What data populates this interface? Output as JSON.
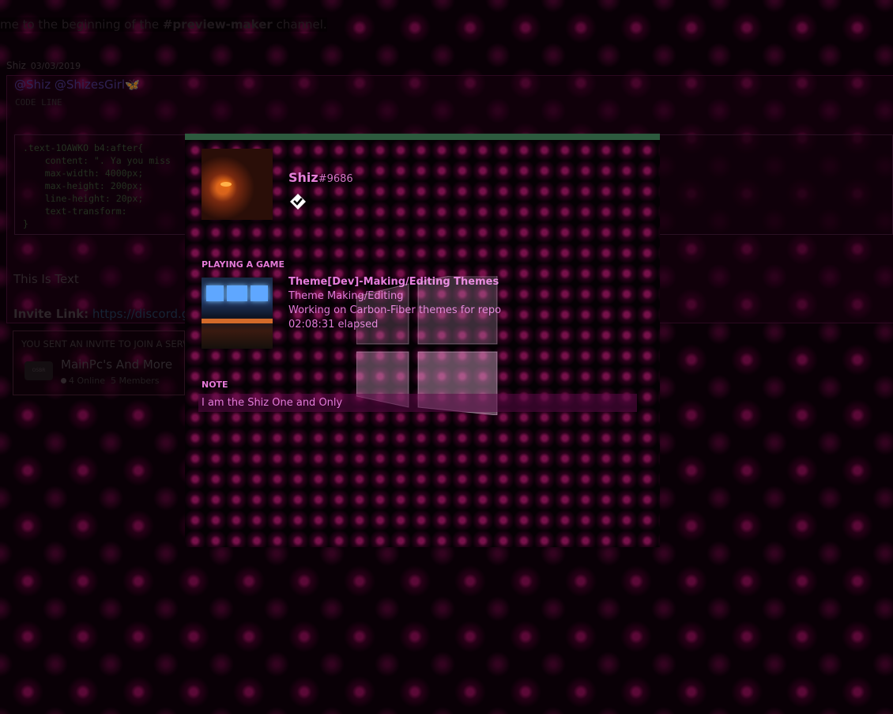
{
  "background_chat": {
    "welcome": {
      "prefix": "me to the beginning of the ",
      "channel": "#preview-maker",
      "suffix": " channel."
    },
    "message": {
      "author": "Shiz",
      "date": "03/03/2019",
      "mention": "@Shiz @ShizesGirl🦋",
      "code_label": "CODE LINE",
      "code_block": ".text-1OAWKO b4:after{\n    content: \". Ya you miss\n    max-width: 4000px;\n    max-height: 200px;\n    line-height: 20px;\n    text-transform:\n}",
      "plain_text": "This Is Text",
      "invite_label": "Invite Link:",
      "invite_url": "https://discord.gg"
    },
    "invite_card": {
      "header": "YOU SENT AN INVITE TO JOIN A SERV",
      "icon_text": "OSBR",
      "server_name": "MainPc's And More",
      "online": "4 Online",
      "members": "5 Members"
    }
  },
  "profile": {
    "username": "Shiz",
    "discriminator": "#9686",
    "badge_icon": "hypesquad-badge-icon",
    "accent_color": "#2d5a3e",
    "playing_label": "PLAYING A GAME",
    "game": {
      "name": "Theme[Dev]-Making/Editing Themes",
      "details": "Theme Making/Editing",
      "state": "Working on Carbon-Fiber themes for repo",
      "elapsed": "02:08:31 elapsed"
    },
    "note_label": "NOTE",
    "note_value": "I am the Shiz One and Only"
  }
}
